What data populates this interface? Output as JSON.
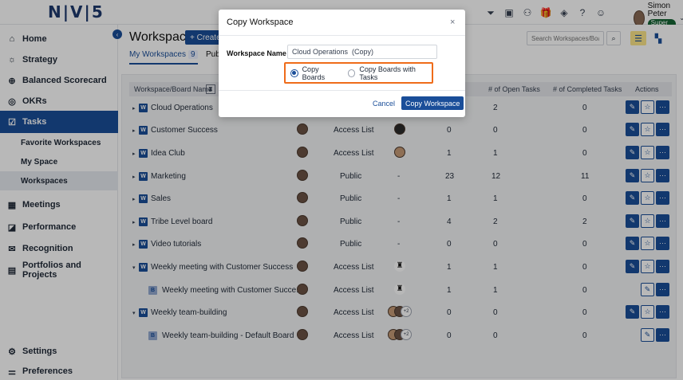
{
  "app": {
    "logo": "N|V|5"
  },
  "topbar": {
    "icons": [
      "filter-icon",
      "gantt-icon",
      "org-icon",
      "gift-icon",
      "layers-icon",
      "help-icon",
      "chat-icon"
    ],
    "gift_count": "7",
    "user_name": "Simon Peter",
    "user_role": "Super User"
  },
  "sidebar": {
    "items": [
      {
        "label": "Home",
        "icon": "⌂"
      },
      {
        "label": "Strategy",
        "icon": "☼"
      },
      {
        "label": "Balanced Scorecard",
        "icon": "⊕"
      },
      {
        "label": "OKRs",
        "icon": "◎"
      },
      {
        "label": "Tasks",
        "icon": "☑"
      },
      {
        "label": "Meetings",
        "icon": "▦"
      },
      {
        "label": "Performance",
        "icon": "◪"
      },
      {
        "label": "Recognition",
        "icon": "✉"
      },
      {
        "label": "Portfolios and Projects",
        "icon": "▤"
      },
      {
        "label": "Settings",
        "icon": "⚙"
      },
      {
        "label": "Preferences",
        "icon": "⚌"
      }
    ],
    "subitems": [
      "Favorite Workspaces",
      "My Space",
      "Workspaces"
    ]
  },
  "main": {
    "title": "Workspaces",
    "create_label": "+ Create",
    "tab_my": "My Workspaces",
    "tab_my_count": "9",
    "tab_public": "Publ",
    "search_placeholder": "Search Workspaces/Boards"
  },
  "table": {
    "headers": {
      "name": "Workspace/Board Name",
      "open": "# of Open Tasks",
      "completed": "# of Completed Tasks",
      "actions": "Actions"
    },
    "rows": [
      {
        "name": "Cloud Operations",
        "access": "",
        "tasks": "",
        "open": "2",
        "completed": "0"
      },
      {
        "name": "Customer Success",
        "access": "Access List",
        "tasks": "0",
        "open": "0",
        "completed": "0"
      },
      {
        "name": "Idea Club",
        "access": "Access List",
        "tasks": "1",
        "open": "1",
        "completed": "0"
      },
      {
        "name": "Marketing",
        "access": "Public",
        "dash": "-",
        "tasks": "23",
        "open": "12",
        "completed": "11"
      },
      {
        "name": "Sales",
        "access": "Public",
        "dash": "-",
        "tasks": "1",
        "open": "1",
        "completed": "0"
      },
      {
        "name": "Tribe Level board",
        "access": "Public",
        "dash": "-",
        "tasks": "4",
        "open": "2",
        "completed": "2"
      },
      {
        "name": "Video tutorials",
        "access": "Public",
        "dash": "-",
        "tasks": "0",
        "open": "0",
        "completed": "0"
      },
      {
        "name": "Weekly meeting with Customer Success",
        "access": "Access List",
        "tasks": "1",
        "open": "1",
        "completed": "0"
      },
      {
        "name": "Weekly meeting with Customer Succe...",
        "access": "Access List",
        "tasks": "1",
        "open": "1",
        "completed": "0"
      },
      {
        "name": "Weekly team-building",
        "access": "Access List",
        "more": "+2",
        "tasks": "0",
        "open": "0",
        "completed": "0"
      },
      {
        "name": "Weekly team-building - Default Board",
        "access": "Access List",
        "more": "+2",
        "tasks": "0",
        "open": "0",
        "completed": "0"
      }
    ]
  },
  "modal": {
    "title": "Copy Workspace",
    "close": "×",
    "name_label": "Workspace Name",
    "name_value": "Cloud Operations  (Copy)",
    "opt1": "Copy Boards",
    "opt2": "Copy Boards with Tasks",
    "cancel": "Cancel",
    "confirm": "Copy Workspace"
  }
}
